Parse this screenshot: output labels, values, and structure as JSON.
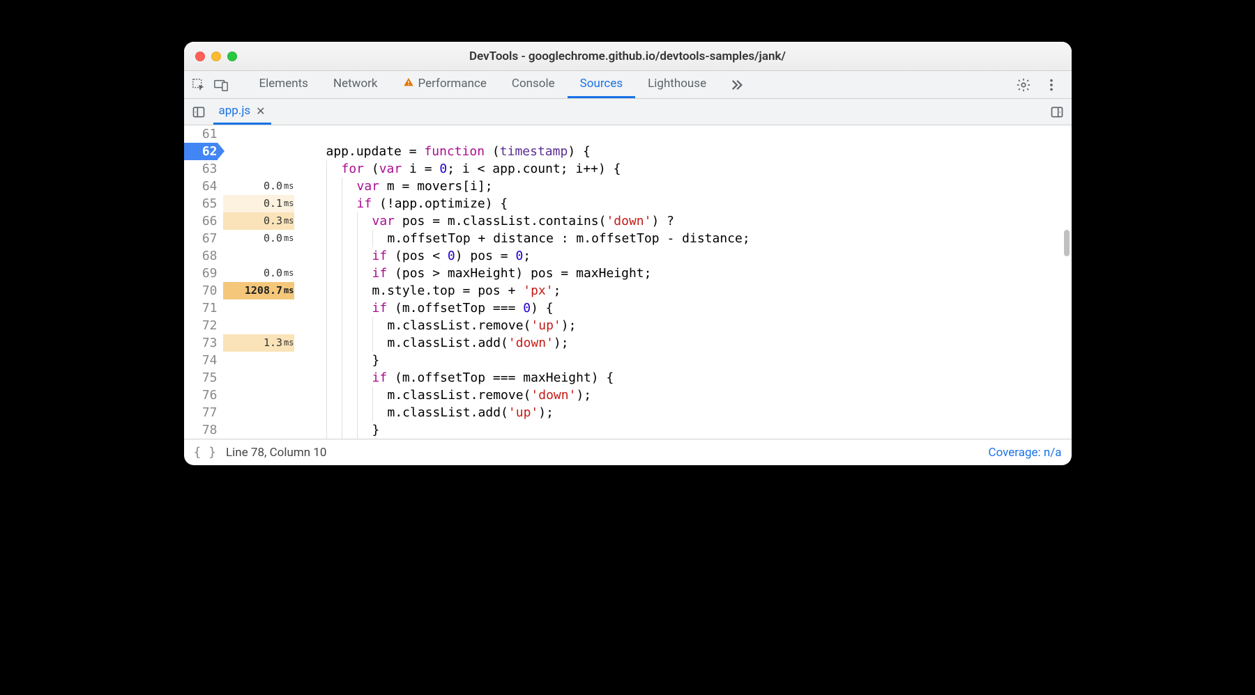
{
  "window": {
    "title": "DevTools - googlechrome.github.io/devtools-samples/jank/"
  },
  "toolbar": {
    "tabs": [
      {
        "label": "Elements",
        "active": false,
        "warning": false
      },
      {
        "label": "Network",
        "active": false,
        "warning": false
      },
      {
        "label": "Performance",
        "active": false,
        "warning": true
      },
      {
        "label": "Console",
        "active": false,
        "warning": false
      },
      {
        "label": "Sources",
        "active": true,
        "warning": false
      },
      {
        "label": "Lighthouse",
        "active": false,
        "warning": false
      }
    ]
  },
  "file_tab": {
    "name": "app.js"
  },
  "gutter": {
    "start": 61,
    "end": 78,
    "breakpoint_line": 62
  },
  "timings": {
    "64": {
      "value": "0.0",
      "unit": "ms",
      "heat": 0
    },
    "65": {
      "value": "0.1",
      "unit": "ms",
      "heat": 1
    },
    "66": {
      "value": "0.3",
      "unit": "ms",
      "heat": 2
    },
    "67": {
      "value": "0.0",
      "unit": "ms",
      "heat": 0
    },
    "69": {
      "value": "0.0",
      "unit": "ms",
      "heat": 0
    },
    "70": {
      "value": "1208.7",
      "unit": "ms",
      "heat": 3
    },
    "73": {
      "value": "1.3",
      "unit": "ms",
      "heat": 2
    }
  },
  "code": {
    "61": {
      "indent": 0,
      "tokens": []
    },
    "62": {
      "indent": 0,
      "tokens": [
        {
          "t": "app.update = "
        },
        {
          "t": "function",
          "c": "fn"
        },
        {
          "t": " ("
        },
        {
          "t": "timestamp",
          "c": "param"
        },
        {
          "t": ") {"
        }
      ]
    },
    "63": {
      "indent": 1,
      "tokens": [
        {
          "t": "for",
          "c": "kw"
        },
        {
          "t": " ("
        },
        {
          "t": "var",
          "c": "kw"
        },
        {
          "t": " i = "
        },
        {
          "t": "0",
          "c": "num"
        },
        {
          "t": "; i < app.count; i++) {"
        }
      ]
    },
    "64": {
      "indent": 2,
      "tokens": [
        {
          "t": "var",
          "c": "kw"
        },
        {
          "t": " m = movers[i];"
        }
      ]
    },
    "65": {
      "indent": 2,
      "tokens": [
        {
          "t": "if",
          "c": "kw"
        },
        {
          "t": " (!app.optimize) {"
        }
      ]
    },
    "66": {
      "indent": 3,
      "tokens": [
        {
          "t": "var",
          "c": "kw"
        },
        {
          "t": " pos = m.classList.contains("
        },
        {
          "t": "'down'",
          "c": "str"
        },
        {
          "t": ") ?"
        }
      ]
    },
    "67": {
      "indent": 4,
      "tokens": [
        {
          "t": "m.offsetTop + distance : m.offsetTop - distance;"
        }
      ]
    },
    "68": {
      "indent": 3,
      "tokens": [
        {
          "t": "if",
          "c": "kw"
        },
        {
          "t": " (pos < "
        },
        {
          "t": "0",
          "c": "num"
        },
        {
          "t": ") pos = "
        },
        {
          "t": "0",
          "c": "num"
        },
        {
          "t": ";"
        }
      ]
    },
    "69": {
      "indent": 3,
      "tokens": [
        {
          "t": "if",
          "c": "kw"
        },
        {
          "t": " (pos > maxHeight) pos = maxHeight;"
        }
      ]
    },
    "70": {
      "indent": 3,
      "tokens": [
        {
          "t": "m.style.top = pos + "
        },
        {
          "t": "'px'",
          "c": "str"
        },
        {
          "t": ";"
        }
      ]
    },
    "71": {
      "indent": 3,
      "tokens": [
        {
          "t": "if",
          "c": "kw"
        },
        {
          "t": " (m.offsetTop === "
        },
        {
          "t": "0",
          "c": "num"
        },
        {
          "t": ") {"
        }
      ]
    },
    "72": {
      "indent": 4,
      "tokens": [
        {
          "t": "m.classList.remove("
        },
        {
          "t": "'up'",
          "c": "str"
        },
        {
          "t": ");"
        }
      ]
    },
    "73": {
      "indent": 4,
      "tokens": [
        {
          "t": "m.classList.add("
        },
        {
          "t": "'down'",
          "c": "str"
        },
        {
          "t": ");"
        }
      ]
    },
    "74": {
      "indent": 3,
      "tokens": [
        {
          "t": "}"
        }
      ]
    },
    "75": {
      "indent": 3,
      "tokens": [
        {
          "t": "if",
          "c": "kw"
        },
        {
          "t": " (m.offsetTop === maxHeight) {"
        }
      ]
    },
    "76": {
      "indent": 4,
      "tokens": [
        {
          "t": "m.classList.remove("
        },
        {
          "t": "'down'",
          "c": "str"
        },
        {
          "t": ");"
        }
      ]
    },
    "77": {
      "indent": 4,
      "tokens": [
        {
          "t": "m.classList.add("
        },
        {
          "t": "'up'",
          "c": "str"
        },
        {
          "t": ");"
        }
      ]
    },
    "78": {
      "indent": 3,
      "tokens": [
        {
          "t": "}"
        }
      ]
    }
  },
  "status": {
    "cursor": "Line 78, Column 10",
    "coverage": "Coverage: n/a"
  }
}
